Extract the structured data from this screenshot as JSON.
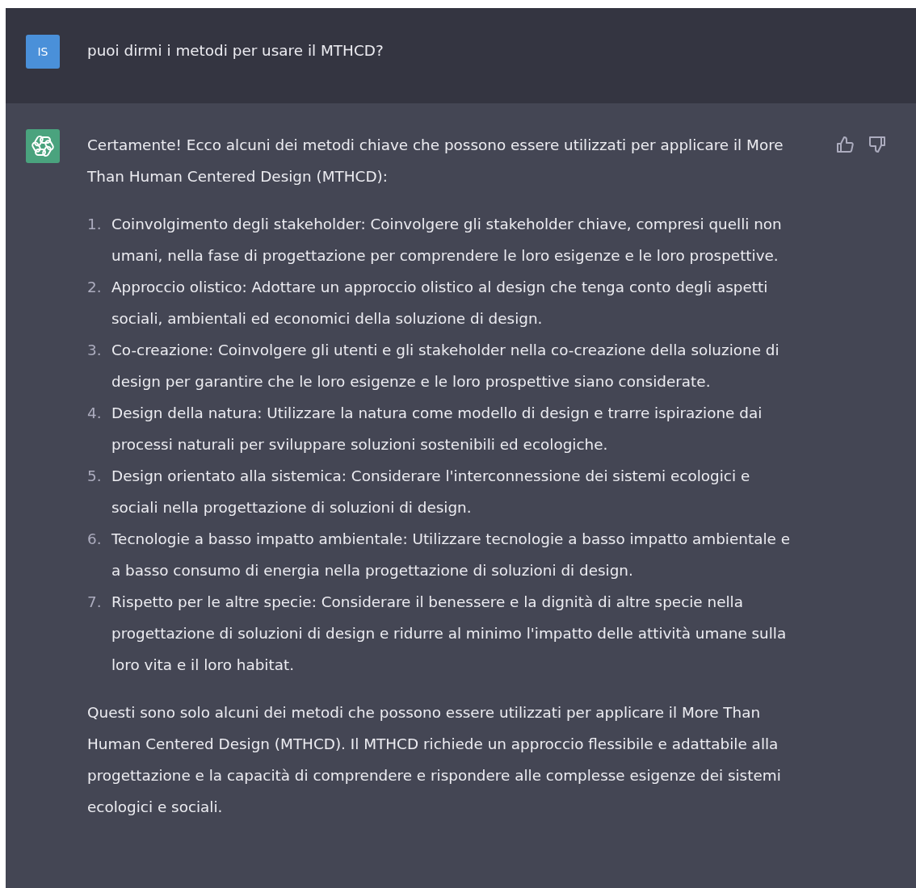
{
  "messages": [
    {
      "kind": "user",
      "avatar": "IS",
      "text": "puoi dirmi i metodi per usare il MTHCD?"
    },
    {
      "kind": "assistant",
      "intro": "Certamente! Ecco alcuni dei metodi chiave che possono essere utilizzati per applicare il More Than Human Centered Design (MTHCD):",
      "items": [
        {
          "number": "1.",
          "text": "Coinvolgimento degli stakeholder: Coinvolgere gli stakeholder chiave, compresi quelli non umani, nella fase di progettazione per comprendere le loro esigenze e le loro prospettive."
        },
        {
          "number": "2.",
          "text": "Approccio olistico: Adottare un approccio olistico al design che tenga conto degli aspetti sociali, ambientali ed economici della soluzione di design."
        },
        {
          "number": "3.",
          "text": "Co-creazione: Coinvolgere gli utenti e gli stakeholder nella co-creazione della soluzione di design per garantire che le loro esigenze e le loro prospettive siano considerate."
        },
        {
          "number": "4.",
          "text": "Design della natura: Utilizzare la natura come modello di design e trarre ispirazione dai processi naturali per sviluppare soluzioni sostenibili ed ecologiche."
        },
        {
          "number": "5.",
          "text": "Design orientato alla sistemica: Considerare l'interconnessione dei sistemi ecologici e sociali nella progettazione di soluzioni di design."
        },
        {
          "number": "6.",
          "text": "Tecnologie a basso impatto ambientale: Utilizzare tecnologie a basso impatto ambientale e a basso consumo di energia nella progettazione di soluzioni di design."
        },
        {
          "number": "7.",
          "text": "Rispetto per le altre specie: Considerare il benessere e la dignità di altre specie nella progettazione di soluzioni di design e ridurre al minimo l'impatto delle attività umane sulla loro vita e il loro habitat."
        }
      ],
      "outro": "Questi sono solo alcuni dei metodi che possono essere utilizzati per applicare il More Than Human Centered Design (MTHCD). Il MTHCD richiede un approccio flessibile e adattabile alla progettazione e la capacità di comprendere e rispondere alle complesse esigenze dei sistemi ecologici e sociali."
    }
  ]
}
